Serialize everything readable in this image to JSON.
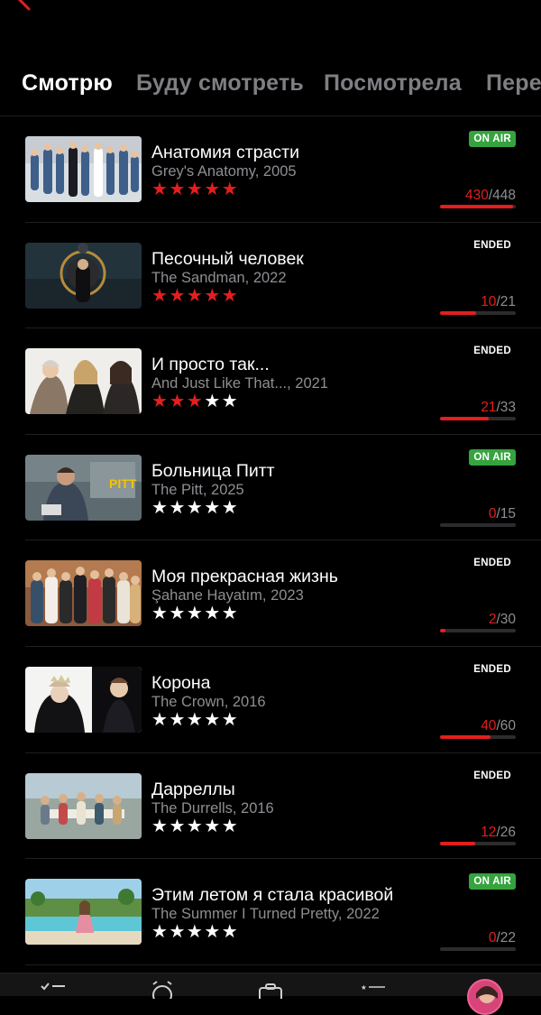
{
  "tabs": [
    {
      "label": "Смотрю",
      "active": true
    },
    {
      "label": "Буду смотреть",
      "active": false
    },
    {
      "label": "Посмотрела",
      "active": false
    },
    {
      "label": "Пере",
      "active": false
    }
  ],
  "colors": {
    "accent": "#e41e1e",
    "on_air": "#36a33e",
    "muted": "#8e8e93"
  },
  "shows": [
    {
      "title": "Анатомия страсти",
      "subtitle": "Grey's Anatomy, 2005",
      "rating": 5,
      "status": "ON AIR",
      "watched": "430",
      "total": "/448",
      "progress": 0.96
    },
    {
      "title": "Песочный человек",
      "subtitle": "The Sandman, 2022",
      "rating": 5,
      "status": "ENDED",
      "watched": "10",
      "total": "/21",
      "progress": 0.48
    },
    {
      "title": "И просто так...",
      "subtitle": "And Just Like That..., 2021",
      "rating": 3,
      "status": "ENDED",
      "watched": "21",
      "total": "/33",
      "progress": 0.64
    },
    {
      "title": "Больница Питт",
      "subtitle": "The Pitt, 2025",
      "rating": 0,
      "status": "ON AIR",
      "watched": "0",
      "total": "/15",
      "progress": 0
    },
    {
      "title": "Моя прекрасная жизнь",
      "subtitle": "Şahane Hayatım, 2023",
      "rating": 0,
      "status": "ENDED",
      "watched": "2",
      "total": "/30",
      "progress": 0.07
    },
    {
      "title": "Корона",
      "subtitle": "The Crown, 2016",
      "rating": 0,
      "status": "ENDED",
      "watched": "40",
      "total": "/60",
      "progress": 0.67
    },
    {
      "title": "Дарреллы",
      "subtitle": "The Durrells, 2016",
      "rating": 0,
      "status": "ENDED",
      "watched": "12",
      "total": "/26",
      "progress": 0.46
    },
    {
      "title": "Этим летом я стала красивой",
      "subtitle": "The Summer I Turned Pretty, 2022",
      "rating": 0,
      "status": "ON AIR",
      "watched": "0",
      "total": "/22",
      "progress": 0
    }
  ],
  "nav": [
    {
      "icon": "checklist-icon"
    },
    {
      "icon": "alarm-clock-icon"
    },
    {
      "icon": "briefcase-icon"
    },
    {
      "icon": "star-list-icon"
    },
    {
      "icon": "avatar"
    }
  ]
}
